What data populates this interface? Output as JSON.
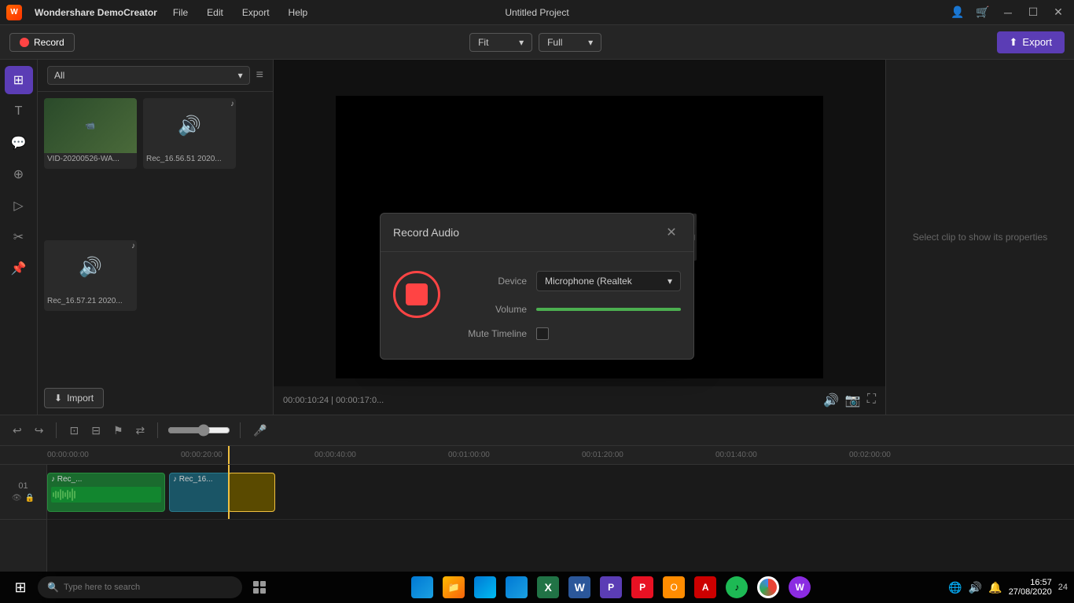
{
  "app": {
    "name": "Wondershare DemoCreator",
    "title": "Untitled Project"
  },
  "menu": {
    "items": [
      "File",
      "Edit",
      "Export",
      "Help"
    ]
  },
  "toolbar": {
    "record_label": "Record",
    "fit_label": "Fit",
    "full_label": "Full",
    "export_label": "Export"
  },
  "media_panel": {
    "filter": "All",
    "import_label": "Import",
    "items": [
      {
        "label": "VID-20200526-WA...",
        "type": "video"
      },
      {
        "label": "Rec_16.56.51 2020...",
        "type": "audio"
      },
      {
        "label": "Rec_16.57.21 2020...",
        "type": "audio"
      }
    ]
  },
  "preview": {
    "time": "00:00:10:24 | 00:00:17:0..."
  },
  "properties": {
    "hint": "Select clip to show its properties"
  },
  "modal": {
    "title": "Record Audio",
    "device_label": "Device",
    "device_value": "Microphone (Realtek",
    "volume_label": "Volume",
    "mute_label": "Mute Timeline",
    "close_label": "×"
  },
  "timeline": {
    "marks": [
      "00:00:00:00",
      "00:00:20:00",
      "00:00:40:00",
      "00:01:00:00",
      "00:01:20:00",
      "00:01:40:00",
      "00:02:00:00"
    ],
    "tracks": [
      {
        "num": "01",
        "clips": [
          {
            "label": "Rec_...",
            "start": 0,
            "width": 150,
            "type": "audio"
          },
          {
            "label": "Rec_16...",
            "start": 155,
            "width": 120,
            "type": "audio"
          }
        ]
      }
    ]
  },
  "taskbar": {
    "search_placeholder": "Type here to search",
    "time": "16:57",
    "date": "27/08/2020",
    "apps": [
      "⊞",
      "⊡",
      "🌐",
      "📁",
      "🛒",
      "✉",
      "X",
      "W",
      "P₁",
      "P₂",
      "✉₂",
      "✓",
      "🎵",
      "🌐₂",
      "🟣"
    ]
  }
}
